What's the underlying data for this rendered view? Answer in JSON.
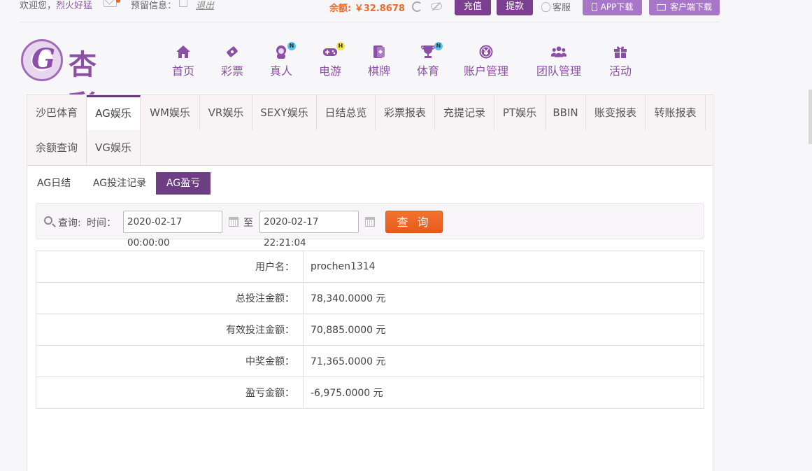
{
  "topbar": {
    "welcome_prefix": "欢迎您，",
    "username": "烈火好猛",
    "reserve_label": "预留信息：",
    "logout": "退出",
    "balance": "余额: ￥32.8678",
    "recharge": "充值",
    "withdraw": "提款",
    "service": "客服",
    "app_download": "APP下载",
    "client_download": "客户端下载"
  },
  "logo": {
    "brand": "杏彩"
  },
  "nav": [
    {
      "label": "首页",
      "icon": "home-icon"
    },
    {
      "label": "彩票",
      "icon": "lottery-icon"
    },
    {
      "label": "真人",
      "icon": "live-dealer-icon",
      "badge": "N"
    },
    {
      "label": "电游",
      "icon": "gamepad-icon",
      "badge": "H"
    },
    {
      "label": "棋牌",
      "icon": "cards-icon"
    },
    {
      "label": "体育",
      "icon": "trophy-icon",
      "badge": "N"
    },
    {
      "label": "账户管理",
      "icon": "yen-coin-icon"
    },
    {
      "label": "团队管理",
      "icon": "team-icon"
    },
    {
      "label": "活动",
      "icon": "gift-icon"
    }
  ],
  "tabs": {
    "row1": [
      "沙巴体育",
      "AG娱乐",
      "WM娱乐",
      "VR娱乐",
      "SEXY娱乐",
      "日结总览",
      "彩票报表",
      "充提记录",
      "PT娱乐",
      "BBIN",
      "账变报表",
      "转账报表"
    ],
    "row2": [
      "余额查询",
      "VG娱乐"
    ],
    "active": "AG娱乐"
  },
  "subtabs": {
    "items": [
      "AG日结",
      "AG投注记录",
      "AG盈亏"
    ],
    "active": "AG盈亏"
  },
  "query": {
    "query_label": "查询:",
    "time_label": "时间：",
    "start": "2020-02-17 00:00:00",
    "to": "至",
    "end": "2020-02-17 22:21:04",
    "button": "查 询"
  },
  "result": {
    "rows": [
      {
        "key": "用户名：",
        "value": "prochen1314"
      },
      {
        "key": "总投注金额：",
        "value": "78,340.0000 元"
      },
      {
        "key": "有效投注金额：",
        "value": "70,885.0000 元"
      },
      {
        "key": "中奖金额：",
        "value": "71,365.0000 元"
      },
      {
        "key": "盈亏金额：",
        "value": "-6,975.0000 元"
      }
    ]
  },
  "colors": {
    "brand_purple": "#7b3f8f",
    "nav_purple": "#8b4fa6",
    "accent_orange": "#f06b2a",
    "download_purple": "#a876c7"
  }
}
